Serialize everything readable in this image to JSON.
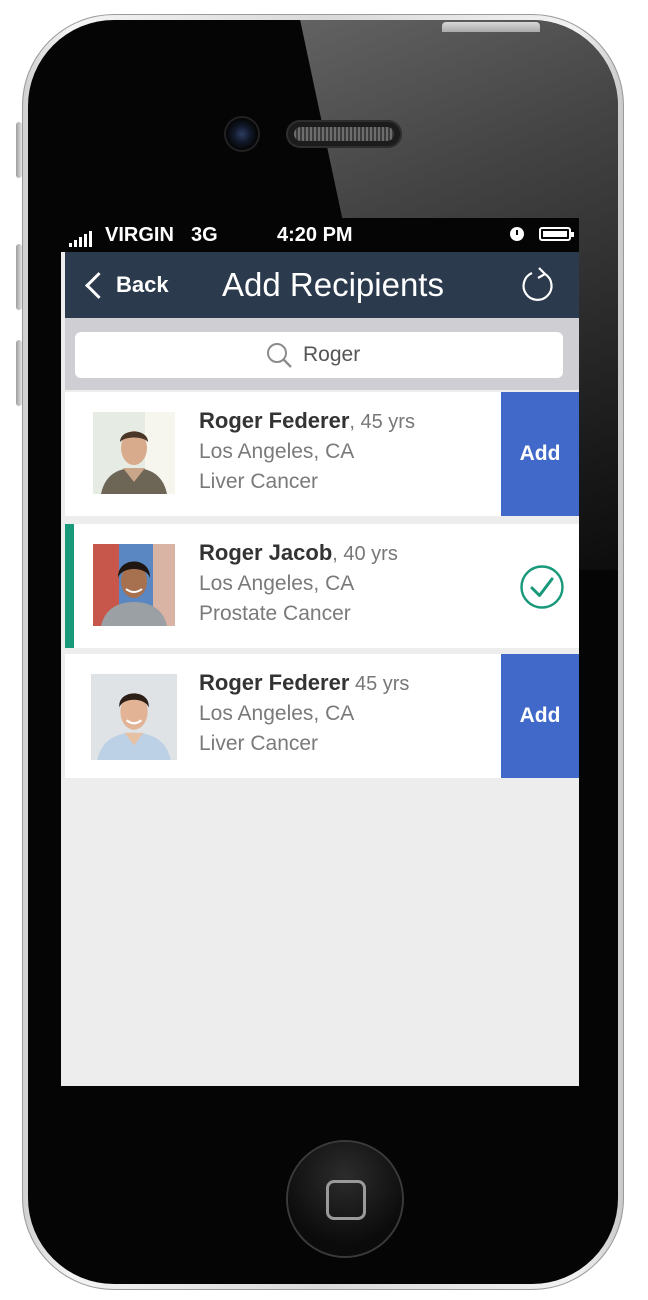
{
  "status_bar": {
    "carrier": "VIRGIN",
    "network": "3G",
    "time": "4:20 PM",
    "icons": [
      "signal-icon",
      "alarm-icon",
      "battery-icon"
    ]
  },
  "nav": {
    "back_label": "Back",
    "title": "Add Recipients",
    "icons": [
      "chevron-left-icon",
      "refresh-icon"
    ]
  },
  "search": {
    "value": "Roger",
    "icon": "search-icon"
  },
  "recipients": [
    {
      "name": "Roger Federer",
      "age": ", 45 yrs",
      "location": "Los Angeles, CA",
      "condition": "Liver Cancer",
      "action": "Add",
      "selected": false
    },
    {
      "name": "Roger Jacob",
      "age": ", 40 yrs",
      "location": "Los Angeles, CA",
      "condition": "Prostate Cancer",
      "action": "added",
      "selected": true
    },
    {
      "name": "Roger Federer",
      "age": " 45 yrs",
      "location": "Los Angeles, CA",
      "condition": "Liver Cancer",
      "action": "Add",
      "selected": false
    }
  ],
  "colors": {
    "navbar": "#2b3a4c",
    "add_button": "#4169c9",
    "selected_accent": "#17997a",
    "screen_background": "#ededed"
  }
}
